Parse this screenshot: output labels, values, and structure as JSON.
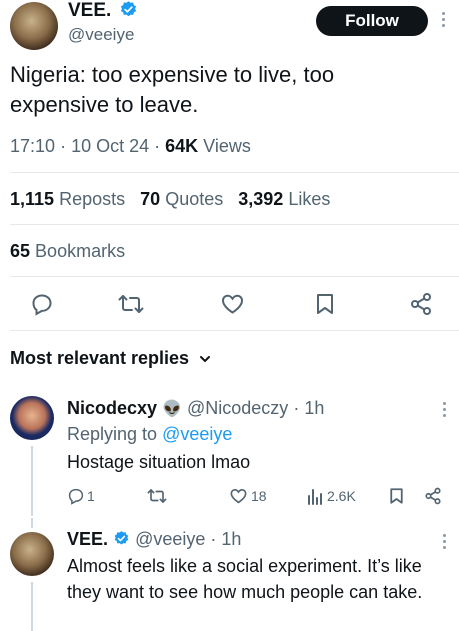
{
  "tweet": {
    "author_name": "VEE.",
    "author_handle": "@veeiye",
    "follow_label": "Follow",
    "text": "Nigeria: too expensive to live, too expensive to leave.",
    "time": "17:10",
    "date": "10 Oct 24",
    "views_count": "64K",
    "views_label": "Views",
    "reposts_count": "1,115",
    "reposts_label": "Reposts",
    "quotes_count": "70",
    "quotes_label": "Quotes",
    "likes_count": "3,392",
    "likes_label": "Likes",
    "bookmarks_count": "65",
    "bookmarks_label": "Bookmarks"
  },
  "replies_sort": {
    "label": "Most relevant replies"
  },
  "reply1": {
    "author_name": "Nicodecxy",
    "emoji": "👽",
    "author_handle": "@Nicodeczy",
    "time": "1h",
    "replying_prefix": "Replying to",
    "replying_handle": "@veeiye",
    "text": "Hostage situation lmao",
    "reply_count": "1",
    "like_count": "18",
    "view_count": "2.6K"
  },
  "reply2": {
    "author_name": "VEE.",
    "author_handle": "@veeiye",
    "time": "1h",
    "text": "Almost feels like a social experiment. It’s like they want to see how much people can take."
  },
  "colors": {
    "text": "#0f1419",
    "secondary": "#536471",
    "verified": "#1d9bf0",
    "link": "#1d9bf0",
    "divider": "#e6e9ec"
  }
}
